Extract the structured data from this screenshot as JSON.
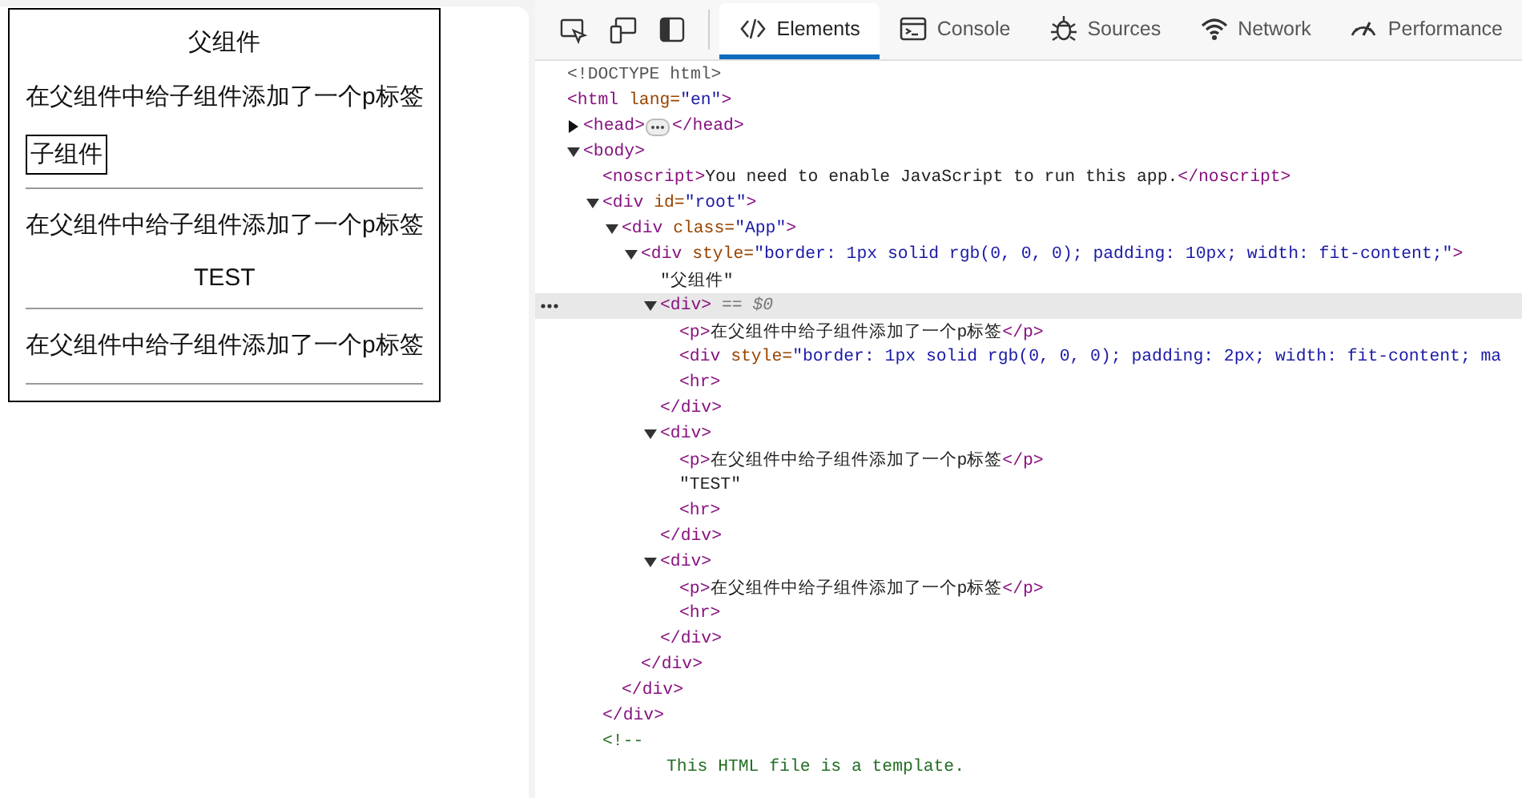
{
  "preview": {
    "title": "父组件",
    "blocks": [
      {
        "paragraph": "在父组件中给子组件添加了一个p标签",
        "kind": "child-box",
        "content": "子组件"
      },
      {
        "paragraph": "在父组件中给子组件添加了一个p标签",
        "kind": "text",
        "content": "TEST"
      },
      {
        "paragraph": "在父组件中给子组件添加了一个p标签",
        "kind": "none"
      }
    ]
  },
  "devtools": {
    "tools": [
      {
        "kind": "inspect"
      },
      {
        "kind": "device"
      },
      {
        "kind": "dock"
      }
    ],
    "tabs": [
      {
        "label": "Elements",
        "kind": "code",
        "selected": true
      },
      {
        "label": "Console",
        "kind": "console",
        "selected": false
      },
      {
        "label": "Sources",
        "kind": "bug",
        "selected": false
      },
      {
        "label": "Network",
        "kind": "wifi",
        "selected": false
      },
      {
        "label": "Performance",
        "kind": "gauge",
        "selected": false
      }
    ],
    "dom_tree": [
      {
        "selected": false,
        "tokens": [
          {
            "kind": "doctype",
            "text": "<!DOCTYPE html>"
          }
        ]
      },
      {
        "selected": false,
        "tokens": [
          {
            "kind": "tag",
            "text": "<html"
          },
          {
            "kind": "attr",
            "text": " lang="
          },
          {
            "kind": "value",
            "text": "\"en\""
          },
          {
            "kind": "tag",
            "text": ">"
          }
        ]
      },
      {
        "selected": false,
        "expanded": false,
        "tokens": [
          {
            "kind": "tag",
            "text": "<head>"
          },
          {
            "kind": "badge"
          },
          {
            "kind": "tag",
            "text": "</head>"
          }
        ]
      },
      {
        "selected": false,
        "expanded": true,
        "tokens": [
          {
            "kind": "tag",
            "text": "<body>"
          }
        ],
        "children": [
          {
            "selected": false,
            "tokens": [
              {
                "kind": "tag",
                "text": "<noscript>"
              },
              {
                "kind": "text",
                "text": "You need to enable JavaScript to run this app."
              },
              {
                "kind": "tag",
                "text": "</noscript>"
              }
            ]
          },
          {
            "selected": false,
            "expanded": true,
            "tokens": [
              {
                "kind": "tag",
                "text": "<div"
              },
              {
                "kind": "attr",
                "text": " id="
              },
              {
                "kind": "value",
                "text": "\"root\""
              },
              {
                "kind": "tag",
                "text": ">"
              }
            ],
            "closing": "</div>",
            "children": [
              {
                "selected": false,
                "expanded": true,
                "tokens": [
                  {
                    "kind": "tag",
                    "text": "<div"
                  },
                  {
                    "kind": "attr",
                    "text": " class="
                  },
                  {
                    "kind": "value",
                    "text": "\"App\""
                  },
                  {
                    "kind": "tag",
                    "text": ">"
                  }
                ],
                "closing": "</div>",
                "children": [
                  {
                    "selected": false,
                    "expanded": true,
                    "tokens": [
                      {
                        "kind": "tag",
                        "text": "<div"
                      },
                      {
                        "kind": "attr",
                        "text": " style="
                      },
                      {
                        "kind": "value",
                        "text": "\"border: 1px solid rgb(0, 0, 0); padding: 10px; width: fit-content;\""
                      },
                      {
                        "kind": "tag",
                        "text": ">"
                      }
                    ],
                    "closing": "</div>",
                    "children": [
                      {
                        "selected": false,
                        "tokens": [
                          {
                            "kind": "text",
                            "text": "\"父组件\""
                          }
                        ]
                      },
                      {
                        "selected": true,
                        "expanded": true,
                        "tokens": [
                          {
                            "kind": "tag",
                            "text": "<div>"
                          },
                          {
                            "kind": "ref",
                            "text": " == $0"
                          }
                        ],
                        "closing": "</div>",
                        "children": [
                          {
                            "selected": false,
                            "tokens": [
                              {
                                "kind": "tag",
                                "text": "<p>"
                              },
                              {
                                "kind": "text",
                                "text": "在父组件中给子组件添加了一个p标签"
                              },
                              {
                                "kind": "tag",
                                "text": "</p>"
                              }
                            ]
                          },
                          {
                            "selected": false,
                            "tokens": [
                              {
                                "kind": "tag",
                                "text": "<div"
                              },
                              {
                                "kind": "attr",
                                "text": " style="
                              },
                              {
                                "kind": "value",
                                "text": "\"border: 1px solid rgb(0, 0, 0); padding: 2px; width: fit-content; ma"
                              }
                            ]
                          },
                          {
                            "selected": false,
                            "tokens": [
                              {
                                "kind": "tag",
                                "text": "<hr>"
                              }
                            ]
                          }
                        ]
                      },
                      {
                        "selected": false,
                        "expanded": true,
                        "tokens": [
                          {
                            "kind": "tag",
                            "text": "<div>"
                          }
                        ],
                        "closing": "</div>",
                        "children": [
                          {
                            "selected": false,
                            "tokens": [
                              {
                                "kind": "tag",
                                "text": "<p>"
                              },
                              {
                                "kind": "text",
                                "text": "在父组件中给子组件添加了一个p标签"
                              },
                              {
                                "kind": "tag",
                                "text": "</p>"
                              }
                            ]
                          },
                          {
                            "selected": false,
                            "tokens": [
                              {
                                "kind": "text",
                                "text": "\"TEST\""
                              }
                            ]
                          },
                          {
                            "selected": false,
                            "tokens": [
                              {
                                "kind": "tag",
                                "text": "<hr>"
                              }
                            ]
                          }
                        ]
                      },
                      {
                        "selected": false,
                        "expanded": true,
                        "tokens": [
                          {
                            "kind": "tag",
                            "text": "<div>"
                          }
                        ],
                        "closing": "</div>",
                        "children": [
                          {
                            "selected": false,
                            "tokens": [
                              {
                                "kind": "tag",
                                "text": "<p>"
                              },
                              {
                                "kind": "text",
                                "text": "在父组件中给子组件添加了一个p标签"
                              },
                              {
                                "kind": "tag",
                                "text": "</p>"
                              }
                            ]
                          },
                          {
                            "selected": false,
                            "tokens": [
                              {
                                "kind": "tag",
                                "text": "<hr>"
                              }
                            ]
                          }
                        ]
                      }
                    ]
                  }
                ]
              }
            ]
          },
          {
            "selected": false,
            "tokens": [
              {
                "kind": "comment",
                "text": "<!--"
              }
            ],
            "comment_lines": [
              "This HTML file is a template."
            ]
          }
        ]
      }
    ]
  }
}
